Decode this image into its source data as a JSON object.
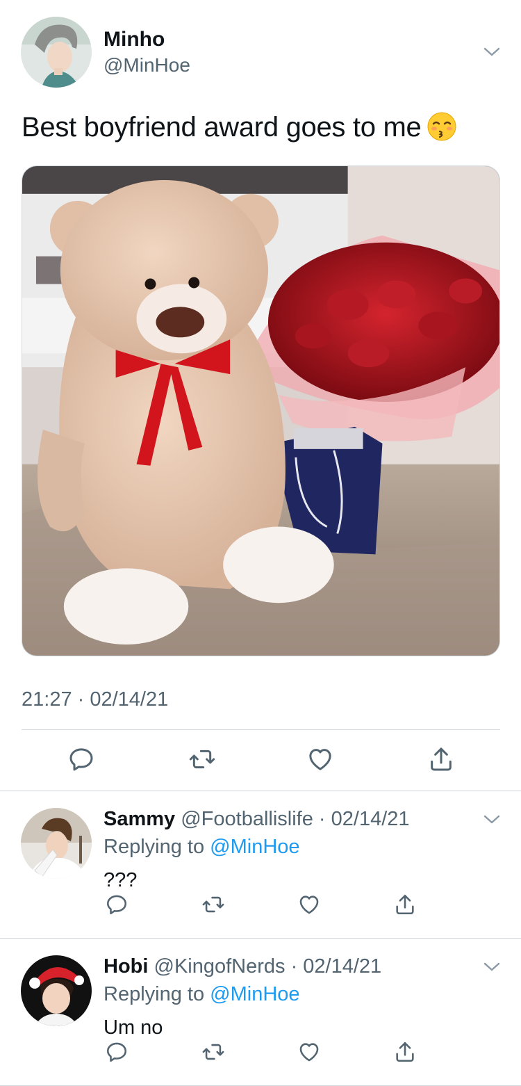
{
  "main_tweet": {
    "name": "Minho",
    "handle": "@MinHoe",
    "text": "Best boyfriend award goes to me",
    "emoji": "kissing-face-with-closed-eyes",
    "timestamp": "21:27 · 02/14/21"
  },
  "replies": [
    {
      "name": "Sammy",
      "meta": "@Footballislife · 02/14/21",
      "replying_prefix": "Replying to",
      "replying_handle": "@MinHoe",
      "text": "???"
    },
    {
      "name": "Hobi",
      "meta": "@KingofNerds · 02/14/21",
      "replying_prefix": "Replying to",
      "replying_handle": "@MinHoe",
      "text": "Um no"
    }
  ],
  "icons": {
    "reply": "reply-icon",
    "retweet": "retweet-icon",
    "like": "like-icon",
    "share": "share-icon",
    "more": "chevron-down-icon"
  },
  "colors": {
    "text": "#0f1419",
    "secondary": "#536471",
    "link": "#1d9bf0",
    "divider": "#cfd9de"
  }
}
